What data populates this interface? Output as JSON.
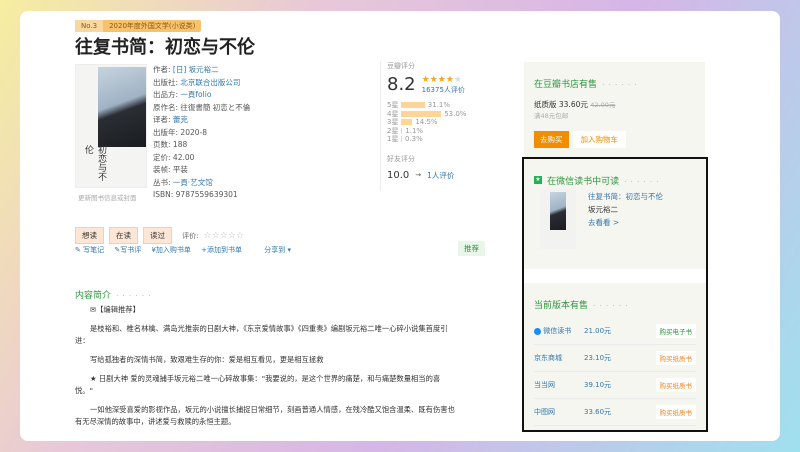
{
  "badge": {
    "rank": "No.3",
    "list": "2020年度外国文学(小说类)"
  },
  "title": "往复书简：初恋与不伦",
  "cover": {
    "text": "初恋与不伦",
    "update_link": "更新图书信息或封面"
  },
  "info": [
    {
      "label": "作者:",
      "value": "[日] 坂元裕二",
      "link": true
    },
    {
      "label": "出版社:",
      "value": "北京联合出版公司",
      "link": true
    },
    {
      "label": "出品方:",
      "value": "一頁folio",
      "link": true
    },
    {
      "label": "原作名:",
      "value": "往復書簡 初恋と不倫",
      "link": false
    },
    {
      "label": "译者:",
      "value": "蕾克",
      "link": true
    },
    {
      "label": "出版年:",
      "value": "2020-8",
      "link": false
    },
    {
      "label": "页数:",
      "value": "188",
      "link": false
    },
    {
      "label": "定价:",
      "value": "42.00",
      "link": false
    },
    {
      "label": "装帧:",
      "value": "平装",
      "link": false
    },
    {
      "label": "丛书:",
      "value": "一頁·艺文馆",
      "link": true
    },
    {
      "label": "ISBN:",
      "value": "9787559639301",
      "link": false
    }
  ],
  "rating": {
    "label": "豆瓣评分",
    "score": "8.2",
    "stars": 4,
    "count": "16375人评价",
    "dist": [
      {
        "l": "5星",
        "p": "31.1%",
        "v": 31.1
      },
      {
        "l": "4星",
        "p": "53.0%",
        "v": 53.0
      },
      {
        "l": "3星",
        "p": "14.5%",
        "v": 14.5
      },
      {
        "l": "2星",
        "p": "1.1%",
        "v": 1.1
      },
      {
        "l": "1星",
        "p": "0.3%",
        "v": 0.3
      }
    ],
    "friend_label": "好友评分",
    "friend_score": "10.0",
    "friend_count": "1人评价"
  },
  "actions": {
    "want": "想读",
    "reading": "在读",
    "read": "读过",
    "rate_label": "评价:",
    "note": "写笔记",
    "review": "写书评",
    "cart": "加入购书单",
    "list": "添加到书单",
    "share": "分享到",
    "recommend": "推荐"
  },
  "intro": {
    "title": "内容简介",
    "dots": "· · · · · ·",
    "paras": [
      "✉【编辑推荐】",
      "是枝裕和、椎名林檎、满岛光推崇的日剧大神，《东京爱情故事》《四重奏》编剧坂元裕二唯一心碎小说集首度引进：",
      "写给孤独者的深情书简，致艰难生存的你：爱是相互看见，更是相互拯救",
      "★ 日剧大神 爱的灵魂捕手坂元裕二唯一心碎故事集：\"我要说的，是这个世界的痛楚，和与痛楚数量相当的喜悦。\"",
      "一如他深受喜爱的影视作品，坂元的小说擅长捕捉日常细节，刻画普通人情感，在残冷酷又饱含温柔、既有伤害也有无尽深情的故事中，讲述爱与救赎的永恒主题。"
    ]
  },
  "store": {
    "title": "在豆瓣书店有售",
    "dots": "· · · · · ·",
    "edition": "纸质版",
    "price": "33.60元",
    "orig": "42.00元",
    "ship": "满48元包邮",
    "buy": "去购买",
    "cart": "加入购物车"
  },
  "weread": {
    "title": "在微信读书中可读",
    "dots": "· · · · · ·",
    "book": "往复书简：初恋与不伦",
    "author": "坂元裕二",
    "go": "去看看 >"
  },
  "sellers": {
    "title": "当前版本有售",
    "dots": "· · · · · ·",
    "rows": [
      {
        "name": "微信读书",
        "price": "21.00元",
        "btn": "购买电子书"
      },
      {
        "name": "京东商城",
        "price": "23.10元",
        "btn": "购买纸质书"
      },
      {
        "name": "当当网",
        "price": "39.10元",
        "btn": "购买纸质书"
      },
      {
        "name": "中图网",
        "price": "33.60元",
        "btn": "购买纸质书"
      }
    ]
  }
}
